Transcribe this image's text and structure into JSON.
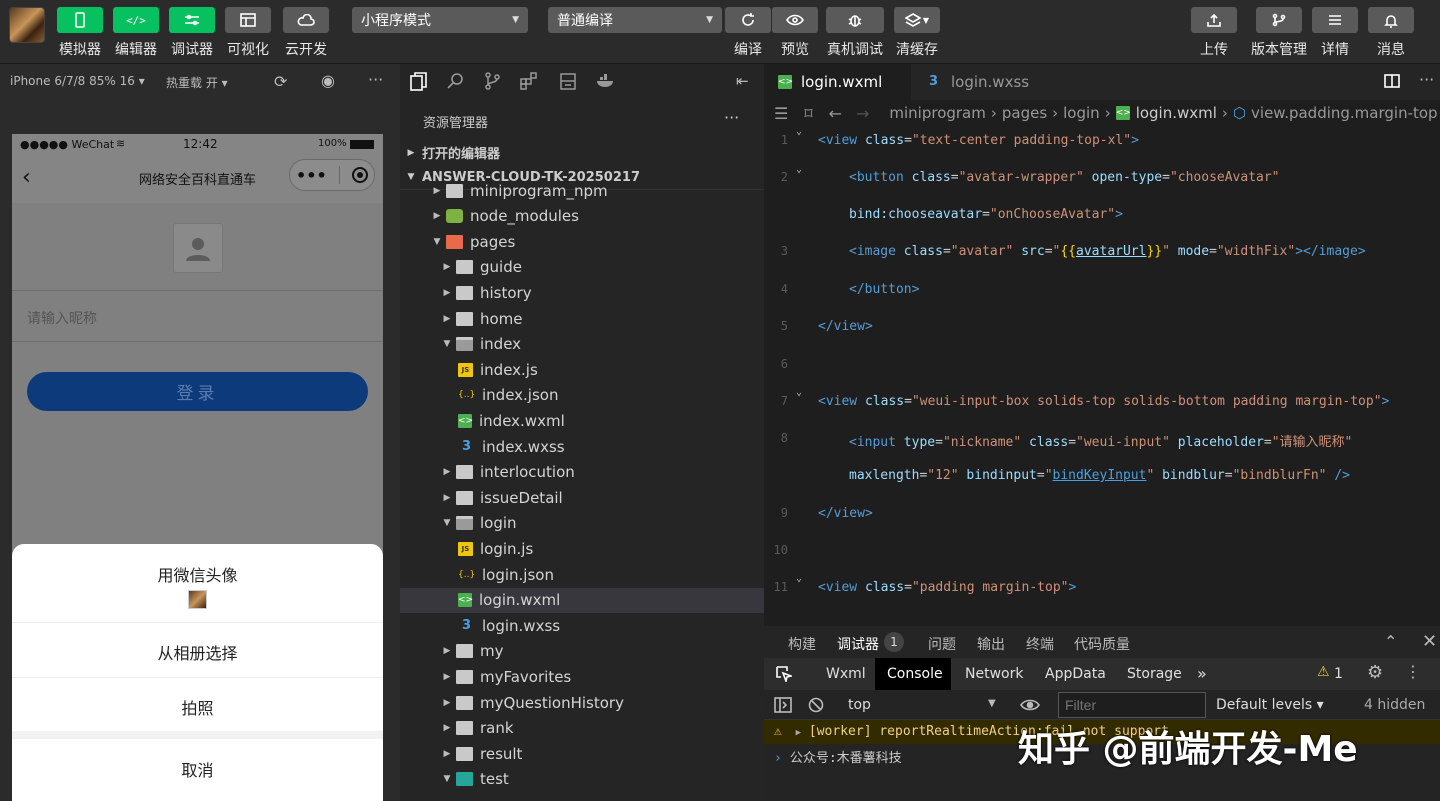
{
  "toolbar": {
    "simulator": "模拟器",
    "editor": "编辑器",
    "debugger": "调试器",
    "visual": "可视化",
    "cloud": "云开发",
    "mode_select": "小程序模式",
    "compile_select": "普通编译",
    "compile": "编译",
    "preview": "预览",
    "real_debug": "真机调试",
    "clear_cache": "清缓存",
    "upload": "上传",
    "version": "版本管理",
    "details": "详情",
    "messages": "消息"
  },
  "simulator": {
    "device": "iPhone 6/7/8 85% 16 ▾",
    "hot_reload": "热重载 开 ▾",
    "status_carrier": "●●●●● WeChat",
    "status_time": "12:42",
    "status_battery": "100%",
    "page_title": "网络安全百科直通车",
    "nickname_placeholder": "请输入昵称",
    "login_button": "登录",
    "sheet": {
      "use_wechat_avatar": "用微信头像",
      "choose_album": "从相册选择",
      "take_photo": "拍照",
      "cancel": "取消"
    }
  },
  "explorer": {
    "title": "资源管理器",
    "more": "···",
    "open_editors": "打开的编辑器",
    "project": "ANSWER-CLOUD-TK-20250217",
    "items": [
      {
        "label": "miniprogram_npm"
      },
      {
        "label": "node_modules"
      },
      {
        "label": "pages"
      },
      {
        "label": "guide"
      },
      {
        "label": "history"
      },
      {
        "label": "home"
      },
      {
        "label": "index"
      },
      {
        "label": "index.js"
      },
      {
        "label": "index.json"
      },
      {
        "label": "index.wxml"
      },
      {
        "label": "index.wxss"
      },
      {
        "label": "interlocution"
      },
      {
        "label": "issueDetail"
      },
      {
        "label": "login"
      },
      {
        "label": "login.js"
      },
      {
        "label": "login.json"
      },
      {
        "label": "login.wxml"
      },
      {
        "label": "login.wxss"
      },
      {
        "label": "my"
      },
      {
        "label": "myFavorites"
      },
      {
        "label": "myQuestionHistory"
      },
      {
        "label": "rank"
      },
      {
        "label": "result"
      },
      {
        "label": "test"
      }
    ]
  },
  "editor": {
    "tab_active": "login.wxml",
    "tab_inactive": "login.wxss",
    "breadcrumb": [
      "miniprogram",
      "pages",
      "login",
      "login.wxml",
      "view.padding.margin-top"
    ],
    "line_numbers": [
      "1",
      "2",
      "3",
      "4",
      "5",
      "6",
      "7",
      "8",
      "9",
      "10",
      "11"
    ]
  },
  "panel": {
    "tabs": [
      "构建",
      "调试器",
      "问题",
      "输出",
      "终端",
      "代码质量"
    ],
    "debugger_count": "1",
    "devtools_tabs": [
      "Wxml",
      "Console",
      "Network",
      "AppData",
      "Storage"
    ],
    "warn_count": "1",
    "context": "top",
    "filter_placeholder": "Filter",
    "levels": "Default levels ▾",
    "hidden": "4 hidden",
    "log_warn": "[worker] reportRealtimeAction:fail not support",
    "log_info": "公众号:木番薯科技"
  },
  "watermark": "知乎 @前端开发-Me"
}
